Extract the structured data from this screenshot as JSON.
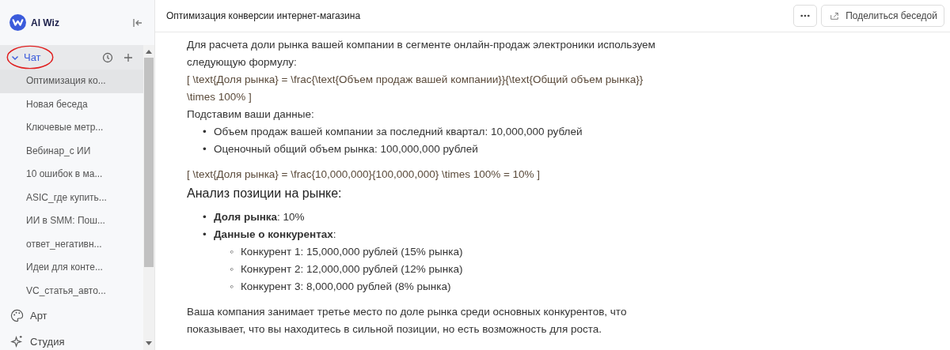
{
  "app": {
    "name": "AI Wiz"
  },
  "sidebar": {
    "chat_section": {
      "label": "Чат",
      "expanded": true,
      "circled": true
    },
    "chats": [
      {
        "title": "Оптимизация ко...",
        "selected": true
      },
      {
        "title": "Новая беседа",
        "selected": false
      },
      {
        "title": "Ключевые метр...",
        "selected": false
      },
      {
        "title": "Вебинар_с ИИ",
        "selected": false
      },
      {
        "title": "10 ошибок в ма...",
        "selected": false
      },
      {
        "title": "ASIC_где купить...",
        "selected": false
      },
      {
        "title": "ИИ в SMM: Пош...",
        "selected": false
      },
      {
        "title": "ответ_негативн...",
        "selected": false
      },
      {
        "title": "Идеи для конте...",
        "selected": false
      },
      {
        "title": "VC_статья_авто...",
        "selected": false
      }
    ],
    "sections": [
      {
        "kind": "art",
        "label": "Арт"
      },
      {
        "kind": "studio",
        "label": "Студия"
      }
    ]
  },
  "header": {
    "title": "Оптимизация конверсии интернет-магазина",
    "share_button": "Поделиться беседой"
  },
  "message": [
    {
      "kind": "paragraph",
      "text": "Для расчета доли рынка вашей компании в сегменте онлайн-продаж электроники используем следующую формулу:"
    },
    {
      "kind": "formula",
      "text": "[ \\text{Доля рынка} = \\frac{\\text{Объем продаж вашей компании}}{\\text{Общий объем рынка}} \\times 100% ]"
    },
    {
      "kind": "paragraph",
      "text": "Подставим ваши данные:"
    },
    {
      "kind": "bullets",
      "items": [
        {
          "marker": "•",
          "text": "Объем продаж вашей компании за последний квартал: 10,000,000 рублей"
        },
        {
          "marker": "•",
          "text": "Оценочный общий объем рынка: 100,000,000 рублей"
        }
      ]
    },
    {
      "kind": "formula",
      "text": "[ \\text{Доля рынка} = \\frac{10,000,000}{100,000,000} \\times 100% = 10% ]",
      "spaced": true
    },
    {
      "kind": "heading",
      "text": "Анализ позиции на рынке:"
    },
    {
      "kind": "bullets",
      "items": [
        {
          "marker": "•",
          "text": "**Доля рынка**: 10%"
        },
        {
          "marker": "•",
          "text": "**Данные о конкурентах**:",
          "children": [
            {
              "marker": "◦",
              "text": "Конкурент 1: 15,000,000 рублей (15% рынка)"
            },
            {
              "marker": "◦",
              "text": "Конкурент 2: 12,000,000 рублей (12% рынка)"
            },
            {
              "marker": "◦",
              "text": "Конкурент 3: 8,000,000 рублей (8% рынка)"
            }
          ]
        }
      ]
    },
    {
      "kind": "paragraph",
      "text": "Ваша компания занимает третье место по доле рынка среди основных конкурентов, что показывает, что вы находитесь в сильной позиции, но есть возможность для роста.",
      "spaced": true
    }
  ]
}
